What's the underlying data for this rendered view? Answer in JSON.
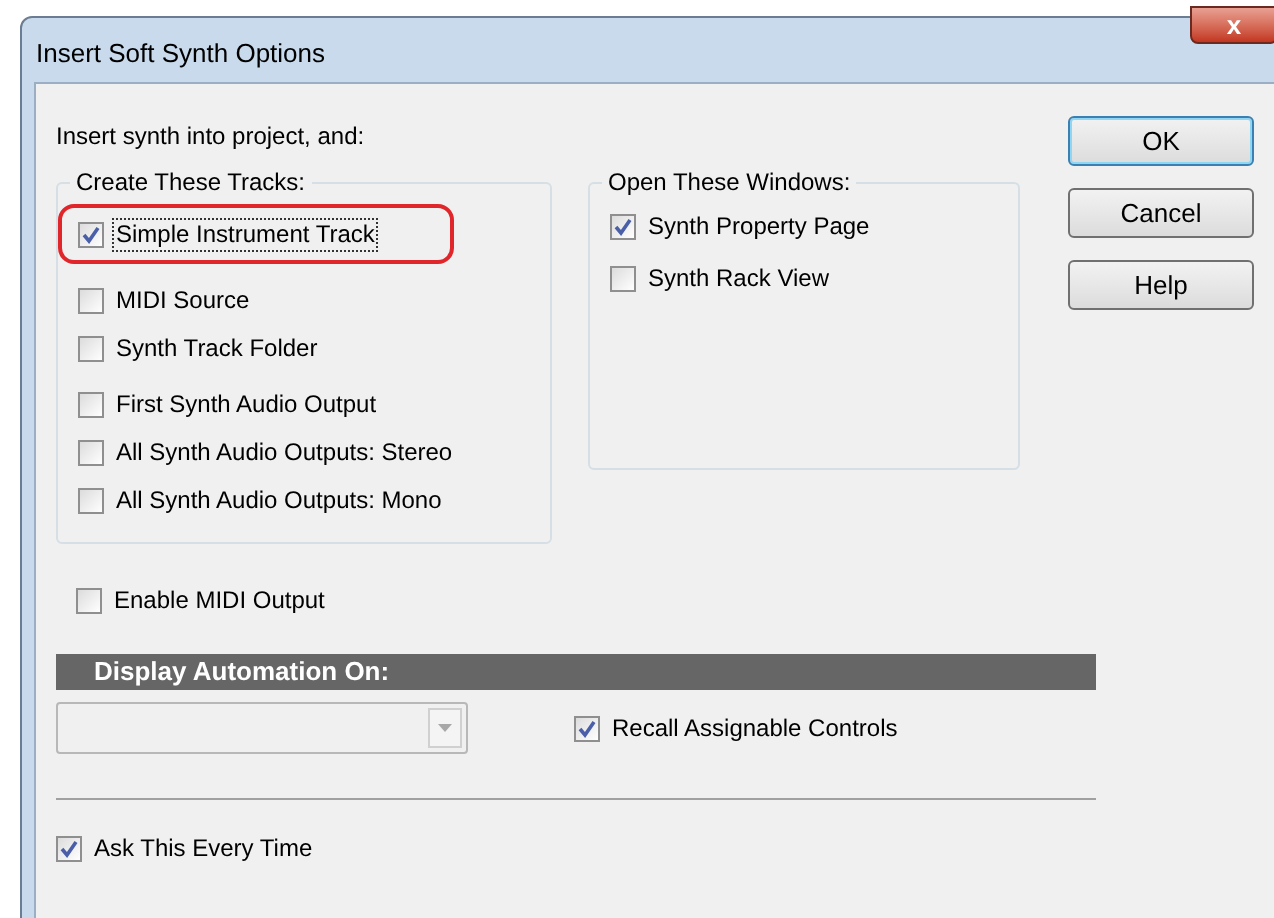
{
  "window": {
    "title": "Insert Soft Synth Options",
    "close_label": "x"
  },
  "intro": "Insert synth into project, and:",
  "create_tracks": {
    "title": "Create These Tracks:",
    "item_groups": [
      [
        {
          "label": "Simple Instrument Track",
          "checked": true,
          "focused": true,
          "highlighted": true
        }
      ],
      [
        {
          "label": "MIDI Source",
          "checked": false,
          "focused": false,
          "highlighted": false
        },
        {
          "label": "Synth Track Folder",
          "checked": false,
          "focused": false,
          "highlighted": false
        }
      ],
      [
        {
          "label": "First Synth Audio Output",
          "checked": false,
          "focused": false,
          "highlighted": false
        },
        {
          "label": "All Synth Audio Outputs: Stereo",
          "checked": false,
          "focused": false,
          "highlighted": false
        },
        {
          "label": "All Synth Audio Outputs: Mono",
          "checked": false,
          "focused": false,
          "highlighted": false
        }
      ]
    ]
  },
  "open_windows": {
    "title": "Open These Windows:",
    "items": [
      {
        "label": "Synth Property Page",
        "checked": true
      },
      {
        "label": "Synth Rack View",
        "checked": false
      }
    ]
  },
  "buttons": [
    {
      "label": "OK",
      "default": true
    },
    {
      "label": "Cancel",
      "default": false
    },
    {
      "label": "Help",
      "default": false
    }
  ],
  "enable_midi_output": {
    "label": "Enable MIDI Output",
    "checked": false
  },
  "display_automation": {
    "title": "Display Automation On:",
    "dropdown": {
      "disabled": true
    },
    "recall": {
      "label": "Recall Assignable Controls",
      "checked": true
    }
  },
  "ask_every_time": {
    "label": "Ask This Every Time",
    "checked": true
  }
}
